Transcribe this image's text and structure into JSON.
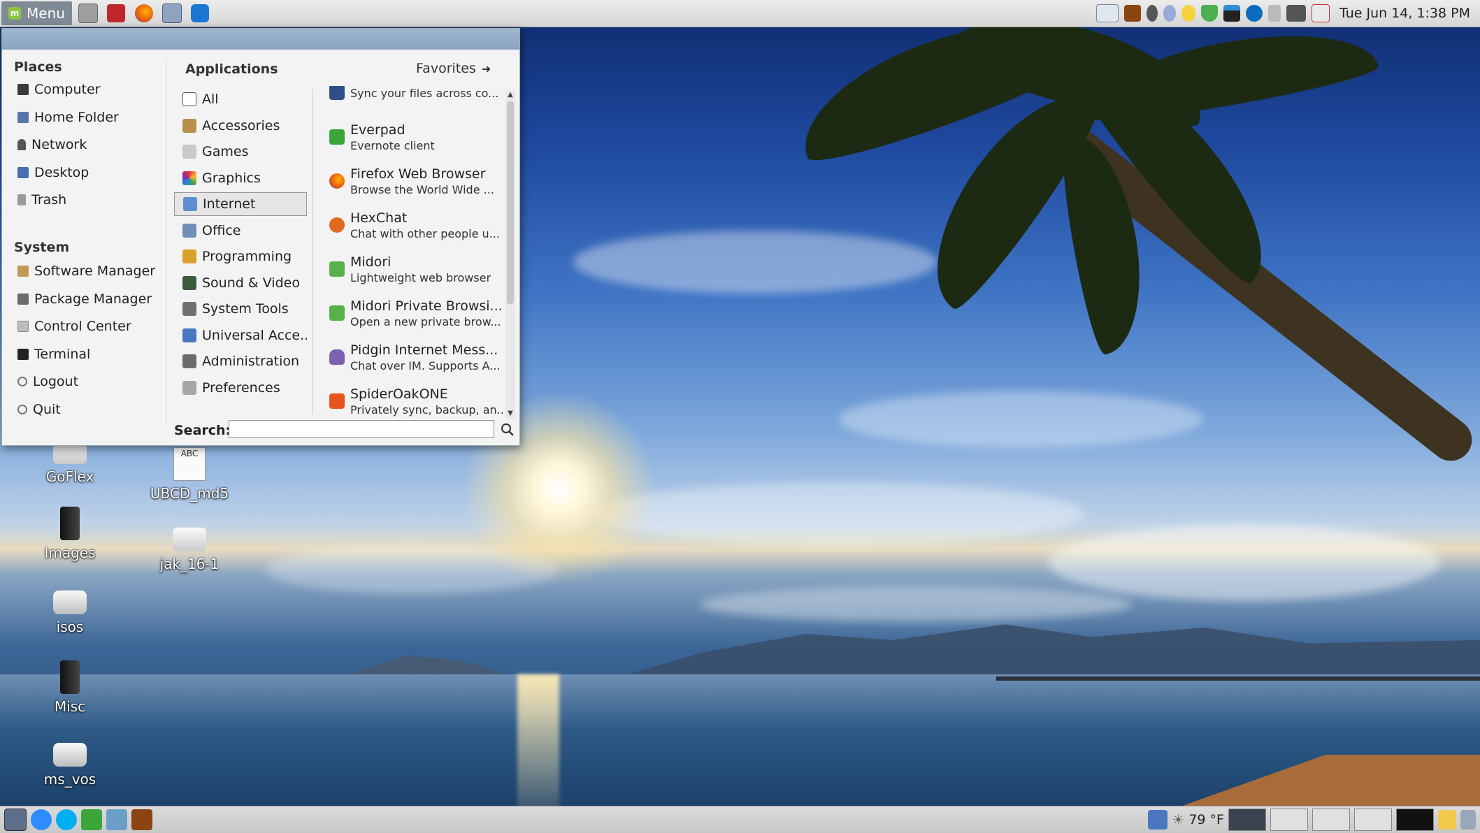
{
  "top_panel": {
    "menu_label": "Menu",
    "launchers": [
      "show-desktop-icon",
      "file-manager-icon",
      "firefox-icon",
      "email-icon",
      "teamviewer-icon"
    ],
    "tray_icons": [
      "network-icon",
      "screenshot-icon",
      "sync-icon",
      "gnome-icon",
      "notes-icon",
      "shield-icon",
      "monitor-icon",
      "hp-icon",
      "volume-icon",
      "pen-icon",
      "weather-icon"
    ],
    "clock": "Tue Jun 14,  1:38 PM"
  },
  "menu": {
    "places_title": "Places",
    "places": [
      {
        "label": "Computer",
        "icon": "computer-icon"
      },
      {
        "label": "Home Folder",
        "icon": "home-folder-icon"
      },
      {
        "label": "Network",
        "icon": "network-icon"
      },
      {
        "label": "Desktop",
        "icon": "desktop-icon"
      },
      {
        "label": "Trash",
        "icon": "trash-icon"
      }
    ],
    "system_title": "System",
    "system": [
      {
        "label": "Software Manager",
        "icon": "software-manager-icon"
      },
      {
        "label": "Package Manager",
        "icon": "package-manager-icon"
      },
      {
        "label": "Control Center",
        "icon": "control-center-icon"
      },
      {
        "label": "Terminal",
        "icon": "terminal-icon"
      },
      {
        "label": "Logout",
        "icon": "logout-icon"
      },
      {
        "label": "Quit",
        "icon": "quit-icon"
      }
    ],
    "applications_title": "Applications",
    "favorites_label": "Favorites",
    "categories": [
      {
        "label": "All",
        "icon": "all-icon"
      },
      {
        "label": "Accessories",
        "icon": "accessories-icon"
      },
      {
        "label": "Games",
        "icon": "games-icon"
      },
      {
        "label": "Graphics",
        "icon": "graphics-icon"
      },
      {
        "label": "Internet",
        "icon": "internet-icon",
        "selected": true
      },
      {
        "label": "Office",
        "icon": "office-icon"
      },
      {
        "label": "Programming",
        "icon": "programming-icon"
      },
      {
        "label": "Sound & Video",
        "icon": "sound-video-icon"
      },
      {
        "label": "System Tools",
        "icon": "system-tools-icon"
      },
      {
        "label": "Universal Acce...",
        "icon": "universal-access-icon"
      },
      {
        "label": "Administration",
        "icon": "administration-icon"
      },
      {
        "label": "Preferences",
        "icon": "preferences-icon"
      }
    ],
    "apps": [
      {
        "name": "",
        "desc": "Sync your files across co...",
        "icon": "dropbox-icon"
      },
      {
        "name": "Everpad",
        "desc": "Evernote client",
        "icon": "everpad-icon"
      },
      {
        "name": "Firefox Web Browser",
        "desc": "Browse the World Wide ...",
        "icon": "firefox-icon"
      },
      {
        "name": "HexChat",
        "desc": "Chat with other people u...",
        "icon": "hexchat-icon"
      },
      {
        "name": "Midori",
        "desc": "Lightweight web browser",
        "icon": "midori-icon"
      },
      {
        "name": "Midori Private Browsi...",
        "desc": "Open a new private brow...",
        "icon": "midori-private-icon"
      },
      {
        "name": "Pidgin Internet Mess...",
        "desc": "Chat over IM.  Supports A...",
        "icon": "pidgin-icon"
      },
      {
        "name": "SpiderOakONE",
        "desc": "Privately sync, backup, an...",
        "icon": "spideroak-icon"
      }
    ],
    "search_label": "Search:",
    "search_value": ""
  },
  "desktop_icons": [
    {
      "label": "GoFlex",
      "icon": "drive-icon"
    },
    {
      "label": "UBCD_md5",
      "icon": "text-file-icon"
    },
    {
      "label": "Images",
      "icon": "drive-icon"
    },
    {
      "label": "jak_16-1",
      "icon": "usb-drive-icon"
    },
    {
      "label": "isos",
      "icon": "hard-disk-icon"
    },
    {
      "label": "Misc",
      "icon": "drive-icon"
    },
    {
      "label": "ms_vos",
      "icon": "hard-disk-icon"
    }
  ],
  "text_file_badge": "ABC",
  "bottom_panel": {
    "launchers": [
      "show-desktop-icon",
      "zoom-icon",
      "skype-icon",
      "everpad-icon",
      "editor-icon",
      "app-icon"
    ],
    "weather": "79 °F"
  },
  "colors": {
    "accent": "#8aa3bd",
    "menu_bg": "#f3f3f3",
    "mint_green": "#8dc63f"
  }
}
